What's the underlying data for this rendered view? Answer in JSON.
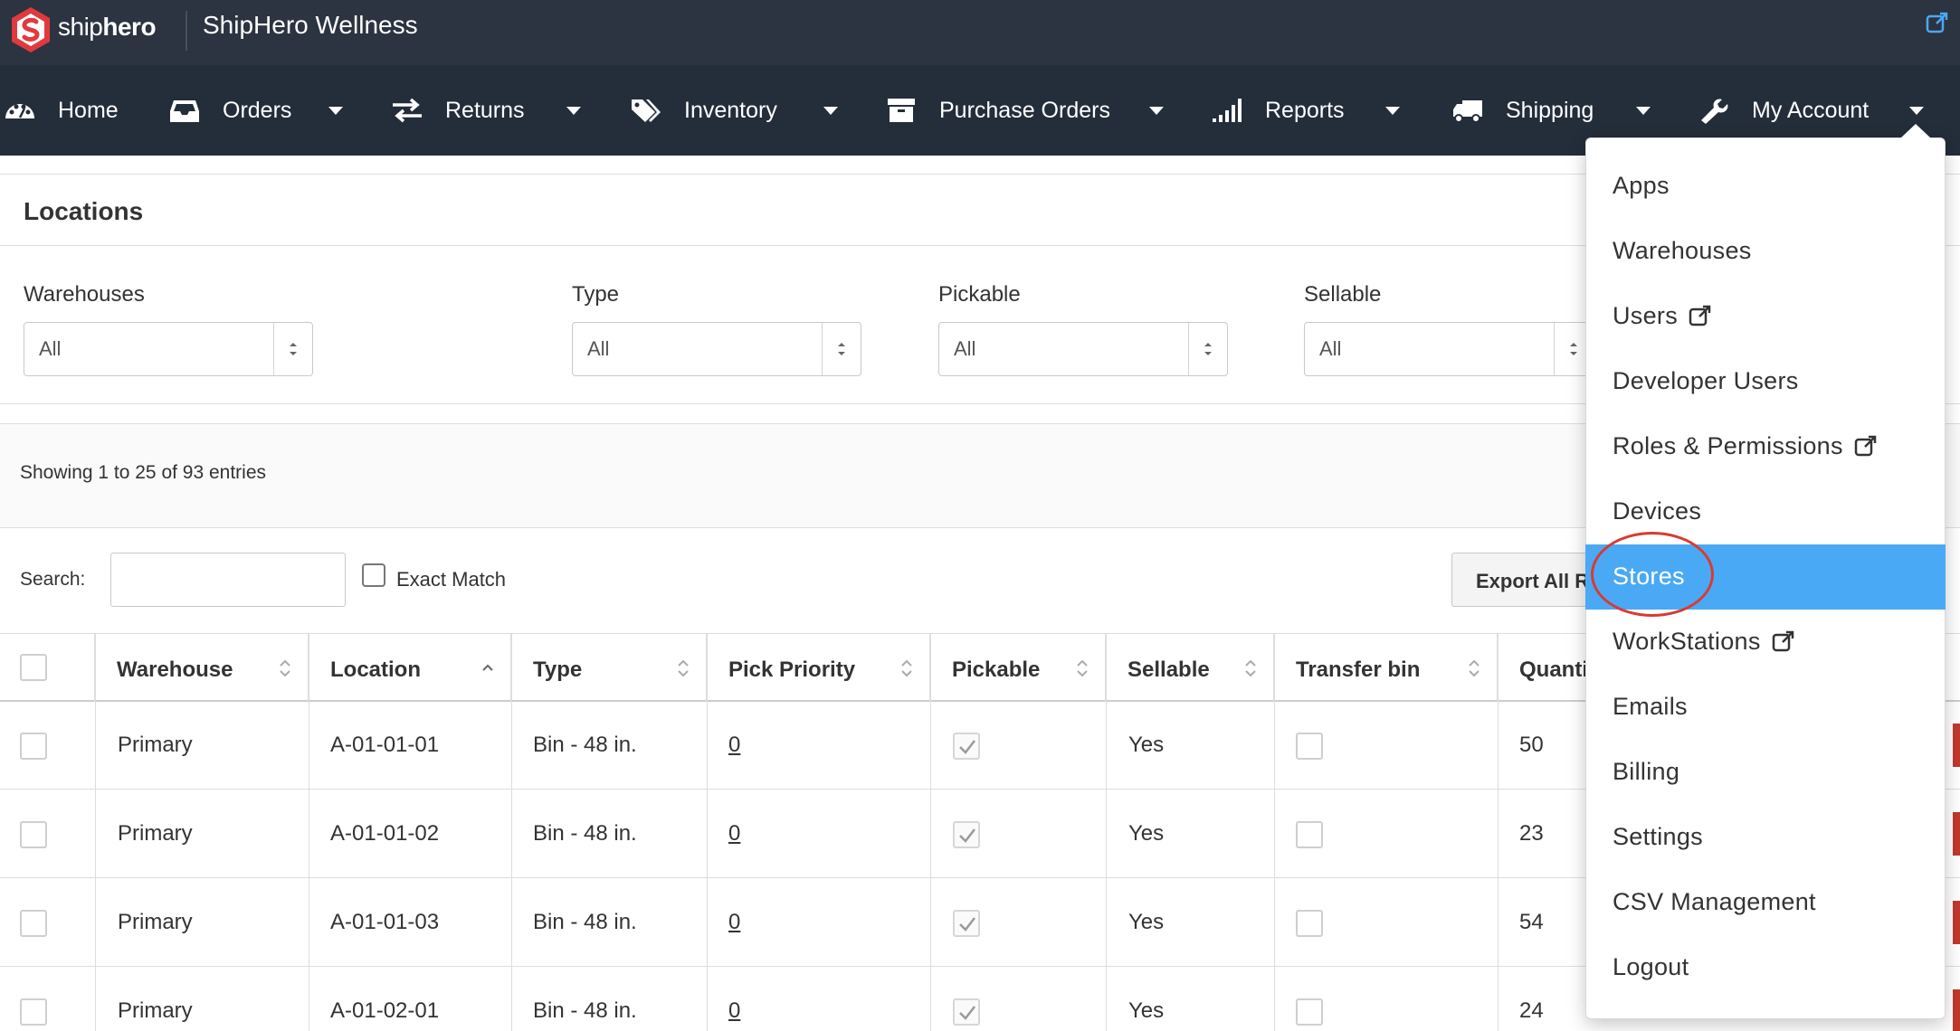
{
  "header": {
    "logo_prefix": "ship",
    "logo_bold": "hero",
    "app_title": "ShipHero Wellness"
  },
  "nav": {
    "items": [
      {
        "label": "Home",
        "icon": "dashboard-icon"
      },
      {
        "label": "Orders",
        "icon": "inbox-icon"
      },
      {
        "label": "Returns",
        "icon": "exchange-icon"
      },
      {
        "label": "Inventory",
        "icon": "tags-icon"
      },
      {
        "label": "Purchase Orders",
        "icon": "archive-icon"
      },
      {
        "label": "Reports",
        "icon": "signal-icon"
      },
      {
        "label": "Shipping",
        "icon": "truck-icon"
      },
      {
        "label": "My Account",
        "icon": "wrench-icon"
      }
    ]
  },
  "locations": {
    "title": "Locations",
    "filters": [
      {
        "label": "Warehouses",
        "value": "All"
      },
      {
        "label": "Type",
        "value": "All"
      },
      {
        "label": "Pickable",
        "value": "All"
      },
      {
        "label": "Sellable",
        "value": "All"
      }
    ],
    "showing": "Showing 1 to 25 of 93 entries",
    "search_label": "Search:",
    "search_value": "",
    "exact_match_label": "Exact Match",
    "export_label": "Export All R"
  },
  "table": {
    "columns": [
      "Warehouse",
      "Location",
      "Type",
      "Pick Priority",
      "Pickable",
      "Sellable",
      "Transfer bin",
      "Quanti"
    ],
    "rows": [
      {
        "warehouse": "Primary",
        "location": "A-01-01-01",
        "type": "Bin - 48 in.",
        "pick_priority": "0",
        "pickable": true,
        "sellable": "Yes",
        "transfer_bin": false,
        "quantity": "50"
      },
      {
        "warehouse": "Primary",
        "location": "A-01-01-02",
        "type": "Bin - 48 in.",
        "pick_priority": "0",
        "pickable": true,
        "sellable": "Yes",
        "transfer_bin": false,
        "quantity": "23"
      },
      {
        "warehouse": "Primary",
        "location": "A-01-01-03",
        "type": "Bin - 48 in.",
        "pick_priority": "0",
        "pickable": true,
        "sellable": "Yes",
        "transfer_bin": false,
        "quantity": "54"
      },
      {
        "warehouse": "Primary",
        "location": "A-01-02-01",
        "type": "Bin - 48 in.",
        "pick_priority": "0",
        "pickable": true,
        "sellable": "Yes",
        "transfer_bin": false,
        "quantity": "24"
      }
    ]
  },
  "account_menu": {
    "items": [
      {
        "label": "Apps",
        "external": false,
        "active": false
      },
      {
        "label": "Warehouses",
        "external": false,
        "active": false
      },
      {
        "label": "Users",
        "external": true,
        "active": false
      },
      {
        "label": "Developer Users",
        "external": false,
        "active": false
      },
      {
        "label": "Roles & Permissions",
        "external": true,
        "active": false
      },
      {
        "label": "Devices",
        "external": false,
        "active": false
      },
      {
        "label": "Stores",
        "external": false,
        "active": true
      },
      {
        "label": "WorkStations",
        "external": true,
        "active": false
      },
      {
        "label": "Emails",
        "external": false,
        "active": false
      },
      {
        "label": "Billing",
        "external": false,
        "active": false
      },
      {
        "label": "Settings",
        "external": false,
        "active": false
      },
      {
        "label": "CSV Management",
        "external": false,
        "active": false
      },
      {
        "label": "Logout",
        "external": false,
        "active": false
      }
    ]
  },
  "colors": {
    "topbar": "#2b3440",
    "navbar": "#242d3a",
    "logo_red": "#e03a3e",
    "active_menu": "#4aa9f5",
    "annotation_circle": "#d93b30"
  }
}
